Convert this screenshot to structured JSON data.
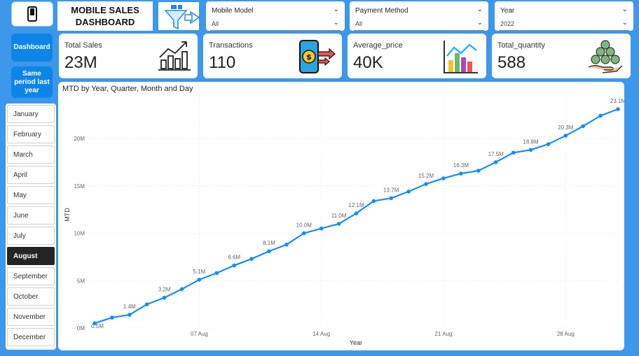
{
  "header": {
    "title_line1": "MOBILE SALES",
    "title_line2": "DASHBOARD"
  },
  "slicers": [
    {
      "label": "Mobile Model",
      "value": "All"
    },
    {
      "label": "Payment Method",
      "value": "All"
    },
    {
      "label": "Year",
      "value": "2022"
    }
  ],
  "kpis": [
    {
      "label": "Total Sales",
      "value": "23M",
      "icon": "growth-chart-icon"
    },
    {
      "label": "Transactions",
      "value": "110",
      "icon": "mobile-payment-icon"
    },
    {
      "label": "Average_price",
      "value": "40K",
      "icon": "bar-chart-icon"
    },
    {
      "label": "Total_quantity",
      "value": "588",
      "icon": "money-hand-icon"
    }
  ],
  "sidebar": {
    "dashboard_label": "Dashboard",
    "same_period_label": "Same period last year"
  },
  "months": {
    "items": [
      "January",
      "February",
      "March",
      "April",
      "May",
      "June",
      "July",
      "August",
      "September",
      "October",
      "November",
      "December"
    ],
    "selected": "August"
  },
  "colors": {
    "accent": "#3d97ea",
    "line": "#118dff",
    "selected_month": "#252423",
    "button": "#0d85e8"
  },
  "chart_data": {
    "type": "line",
    "title": "MTD by Year, Quarter, Month and Day",
    "xlabel": "Year",
    "ylabel": "MTD",
    "x_ticks": [
      "07 Aug",
      "14 Aug",
      "21 Aug",
      "28 Aug"
    ],
    "y_ticks": [
      "0M",
      "5M",
      "10M",
      "15M",
      "20M"
    ],
    "ylim": [
      0,
      24000000
    ],
    "x": [
      "01 Aug",
      "02 Aug",
      "03 Aug",
      "04 Aug",
      "05 Aug",
      "06 Aug",
      "07 Aug",
      "08 Aug",
      "09 Aug",
      "10 Aug",
      "11 Aug",
      "12 Aug",
      "13 Aug",
      "14 Aug",
      "15 Aug",
      "16 Aug",
      "17 Aug",
      "18 Aug",
      "19 Aug",
      "20 Aug",
      "21 Aug",
      "22 Aug",
      "23 Aug",
      "24 Aug",
      "25 Aug",
      "26 Aug",
      "27 Aug",
      "28 Aug",
      "29 Aug",
      "30 Aug",
      "31 Aug"
    ],
    "values": [
      0.5,
      1.1,
      1.4,
      2.5,
      3.2,
      4.1,
      5.1,
      5.8,
      6.6,
      7.3,
      8.1,
      8.8,
      10.0,
      10.5,
      11.0,
      12.1,
      13.4,
      13.7,
      14.4,
      15.2,
      15.8,
      16.3,
      16.6,
      17.5,
      18.5,
      18.8,
      19.4,
      20.3,
      21.3,
      22.4,
      23.1
    ],
    "data_labels": [
      {
        "index": 0,
        "text": "0.5M"
      },
      {
        "index": 2,
        "text": "1.4M"
      },
      {
        "index": 4,
        "text": "3.2M"
      },
      {
        "index": 6,
        "text": "5.1M"
      },
      {
        "index": 8,
        "text": "6.6M"
      },
      {
        "index": 10,
        "text": "8.1M"
      },
      {
        "index": 12,
        "text": "10.0M"
      },
      {
        "index": 14,
        "text": "11.0M"
      },
      {
        "index": 15,
        "text": "12.1M"
      },
      {
        "index": 17,
        "text": "13.7M"
      },
      {
        "index": 19,
        "text": "15.2M"
      },
      {
        "index": 21,
        "text": "16.3M"
      },
      {
        "index": 23,
        "text": "17.5M"
      },
      {
        "index": 25,
        "text": "18.8M"
      },
      {
        "index": 27,
        "text": "20.3M"
      },
      {
        "index": 30,
        "text": "23.1M"
      }
    ],
    "value_unit": "M",
    "grid": true
  }
}
